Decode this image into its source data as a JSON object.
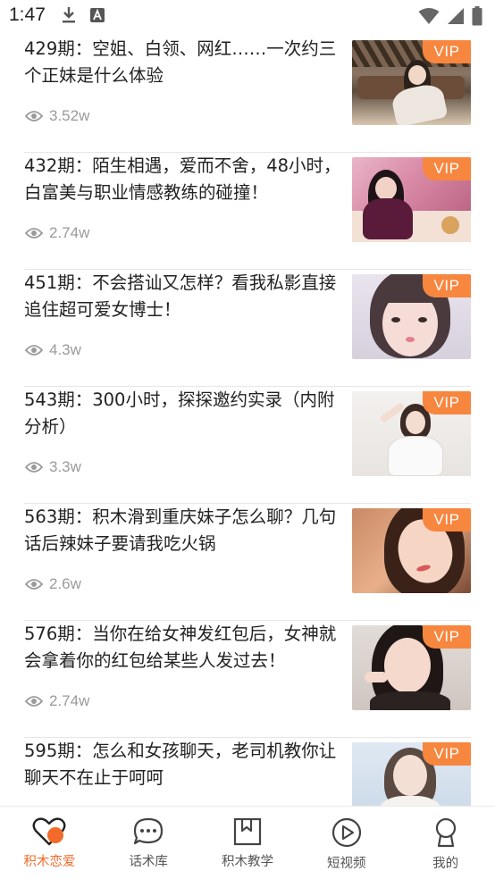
{
  "status_bar": {
    "time": "1:47"
  },
  "feed": {
    "items": [
      {
        "title": "429期：空姐、白领、网红……一次约三个正妹是什么体验",
        "views": "3.52w",
        "badge": "VIP"
      },
      {
        "title": "432期：陌生相遇，爱而不舍，48小时，白富美与职业情感教练的碰撞！",
        "views": "2.74w",
        "badge": "VIP"
      },
      {
        "title": "451期：不会搭讪又怎样？看我私影直接追住超可爱女博士！",
        "views": "4.3w",
        "badge": "VIP"
      },
      {
        "title": "543期：300小时，探探邀约实录（内附分析）",
        "views": "3.3w",
        "badge": "VIP"
      },
      {
        "title": "563期：积木滑到重庆妹子怎么聊？几句话后辣妹子要请我吃火锅",
        "views": "2.6w",
        "badge": "VIP"
      },
      {
        "title": "576期：当你在给女神发红包后，女神就会拿着你的红包给某些人发过去！",
        "views": "2.74w",
        "badge": "VIP"
      },
      {
        "title": "595期：怎么和女孩聊天，老司机教你让聊天不在止于呵呵",
        "views": "",
        "badge": "VIP"
      }
    ]
  },
  "tabbar": {
    "tabs": [
      {
        "label": "积木恋爱",
        "icon": "heart-icon",
        "active": true
      },
      {
        "label": "话术库",
        "icon": "chat-bubble-icon",
        "active": false
      },
      {
        "label": "积木教学",
        "icon": "bookmark-icon",
        "active": false
      },
      {
        "label": "短视频",
        "icon": "play-circle-icon",
        "active": false
      },
      {
        "label": "我的",
        "icon": "user-icon",
        "active": false
      }
    ]
  },
  "colors": {
    "accent": "#f26b2a",
    "vip_badge": "#f7863f",
    "muted_text": "#9a9a9a"
  }
}
